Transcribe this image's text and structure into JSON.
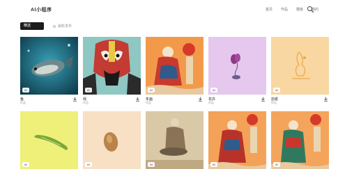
{
  "header": {
    "logo_text": "AI小程序",
    "nav": [
      "首页",
      "作品",
      "模板",
      "我的"
    ]
  },
  "toolbar": {
    "filter_chip": "精选",
    "sort_label": "最新发布"
  },
  "cards": [
    {
      "title": "鱼",
      "sub": "作品",
      "badge": "AI"
    },
    {
      "title": "戏",
      "sub": "作品",
      "badge": "AI"
    },
    {
      "title": "年画",
      "sub": "作品",
      "badge": "AI"
    },
    {
      "title": "花卉",
      "sub": "作品",
      "badge": "AI"
    },
    {
      "title": "剪纸",
      "sub": "作品",
      "badge": "AI"
    },
    {
      "title": "",
      "sub": "",
      "badge": "AI"
    },
    {
      "title": "",
      "sub": "",
      "badge": "AI"
    },
    {
      "title": "",
      "sub": "",
      "badge": "AI"
    },
    {
      "title": "",
      "sub": "",
      "badge": "AI"
    },
    {
      "title": "",
      "sub": "",
      "badge": "AI"
    }
  ],
  "icons": {
    "search": "search-icon",
    "download": "download-icon"
  }
}
